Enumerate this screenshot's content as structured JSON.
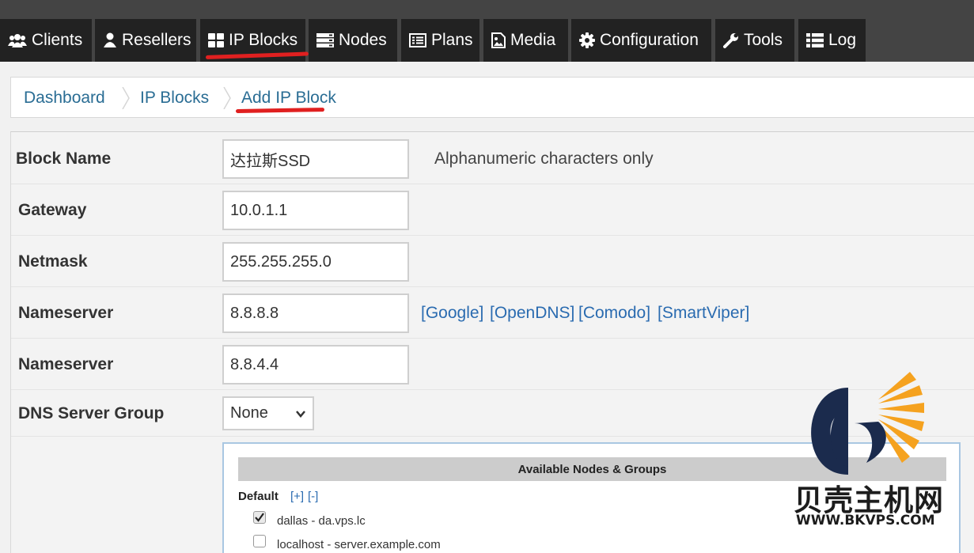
{
  "nav": {
    "tabs": [
      {
        "label": "Clients",
        "icon": "users-icon"
      },
      {
        "label": "Resellers",
        "icon": "user-icon"
      },
      {
        "label": "IP Blocks",
        "icon": "th-large-icon"
      },
      {
        "label": "Nodes",
        "icon": "server-icon"
      },
      {
        "label": "Plans",
        "icon": "list-alt-icon"
      },
      {
        "label": "Media",
        "icon": "file-image-icon"
      },
      {
        "label": "Configuration",
        "icon": "gear-icon"
      },
      {
        "label": "Tools",
        "icon": "wrench-icon"
      },
      {
        "label": "Log",
        "icon": "list-icon"
      }
    ]
  },
  "breadcrumb": {
    "items": [
      "Dashboard",
      "IP Blocks",
      "Add IP Block"
    ]
  },
  "form": {
    "block_name": {
      "label": "Block Name",
      "value": "达拉斯SSD",
      "hint": "Alphanumeric characters only"
    },
    "gateway": {
      "label": "Gateway",
      "value": "10.0.1.1"
    },
    "netmask": {
      "label": "Netmask",
      "value": "255.255.255.0"
    },
    "nameserver1": {
      "label": "Nameserver",
      "value": "8.8.8.8"
    },
    "nameserver2": {
      "label": "Nameserver",
      "value": "8.8.4.4"
    },
    "dns_presets": [
      "[Google]",
      "[OpenDNS]",
      "[Comodo]",
      "[SmartViper]"
    ],
    "dns_group": {
      "label": "DNS Server Group",
      "selected": "None"
    }
  },
  "nodes": {
    "header": "Available Nodes & Groups",
    "group": "Default",
    "expand": "[+]",
    "collapse": "[-]",
    "items": [
      {
        "label": "dallas - da.vps.lc",
        "checked": true
      },
      {
        "label": "localhost - server.example.com",
        "checked": false
      }
    ]
  },
  "watermark": {
    "cn": "贝壳主机网",
    "en": "WWW.BKVPS.COM"
  },
  "colors": {
    "nav_bg": "#444444",
    "tab_bg": "#222222",
    "link": "#2a6d94",
    "annotation": "#e02020"
  }
}
